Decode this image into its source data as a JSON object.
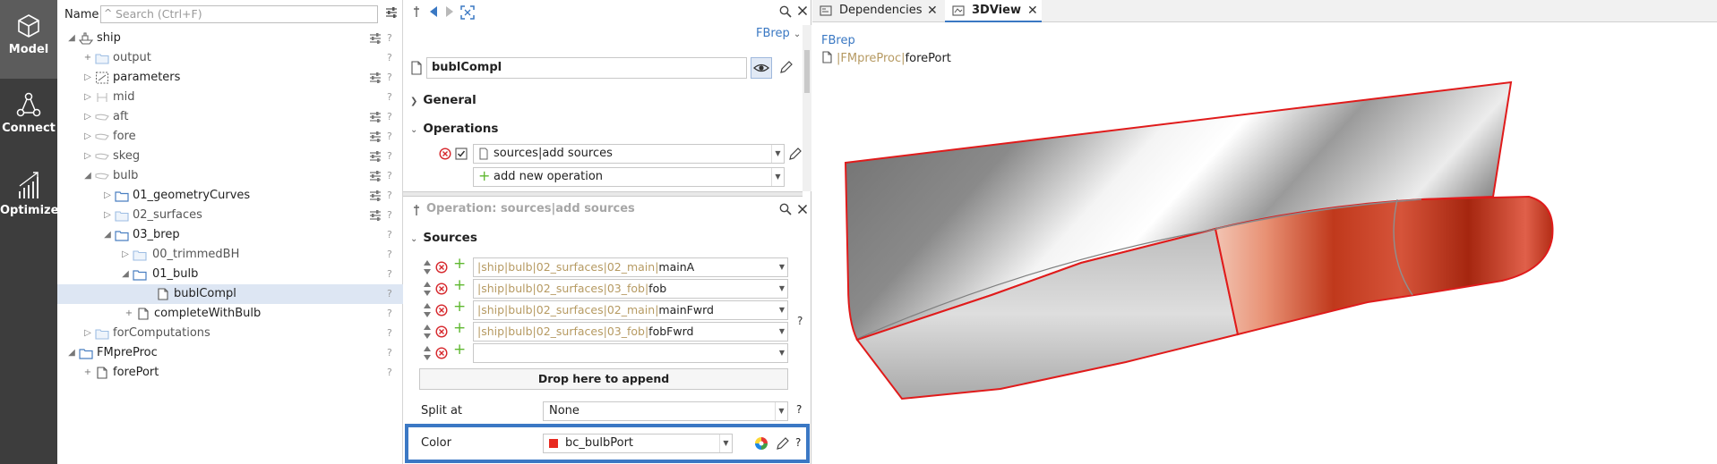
{
  "rail": {
    "items": [
      {
        "label": "Model"
      },
      {
        "label": "Connect"
      },
      {
        "label": "Optimize"
      }
    ]
  },
  "tree": {
    "name_label": "Name",
    "search_placeholder": "Search (Ctrl+F)",
    "rows": [
      {
        "label": "ship"
      },
      {
        "label": "output"
      },
      {
        "label": "parameters"
      },
      {
        "label": "mid"
      },
      {
        "label": "aft"
      },
      {
        "label": "fore"
      },
      {
        "label": "skeg"
      },
      {
        "label": "bulb"
      },
      {
        "label": "01_geometryCurves"
      },
      {
        "label": "02_surfaces"
      },
      {
        "label": "03_brep"
      },
      {
        "label": "00_trimmedBH"
      },
      {
        "label": "01_bulb"
      },
      {
        "label": "bublCompl"
      },
      {
        "label": "completeWithBulb"
      },
      {
        "label": "forComputations"
      },
      {
        "label": "FMpreProc"
      },
      {
        "label": "forePort"
      }
    ],
    "help": "?"
  },
  "editor": {
    "type_combo": "FBrep",
    "object_name": "bublCompl",
    "sections": {
      "general": "General",
      "operations": "Operations",
      "sources": "Sources"
    },
    "operation_value": "sources|add sources",
    "add_operation": "add new operation",
    "operation_header": "Operation: sources|add sources",
    "sources": [
      {
        "path": "|ship|bulb|02_surfaces|02_main|",
        "leaf": "mainA"
      },
      {
        "path": "|ship|bulb|02_surfaces|03_fob|",
        "leaf": "fob"
      },
      {
        "path": "|ship|bulb|02_surfaces|02_main|",
        "leaf": "mainFwrd"
      },
      {
        "path": "|ship|bulb|02_surfaces|03_fob|",
        "leaf": "fobFwrd"
      }
    ],
    "drop_zone": "Drop here to append",
    "split_at_label": "Split at",
    "split_at_value": "None",
    "color_label": "Color",
    "color_value": "bc_bulbPort",
    "color_swatch": "#e8291f",
    "help": "?"
  },
  "view": {
    "tabs": [
      {
        "label": "Dependencies"
      },
      {
        "label": "3DView"
      }
    ],
    "type_label": "FBrep",
    "object_path": "|FMpreProc|",
    "object_leaf": "forePort"
  },
  "colors": {
    "accent": "#3a78c3",
    "rail": "#3d3d3d",
    "hull_edge": "#e01b1b",
    "bulb_red": "#c8361c"
  }
}
